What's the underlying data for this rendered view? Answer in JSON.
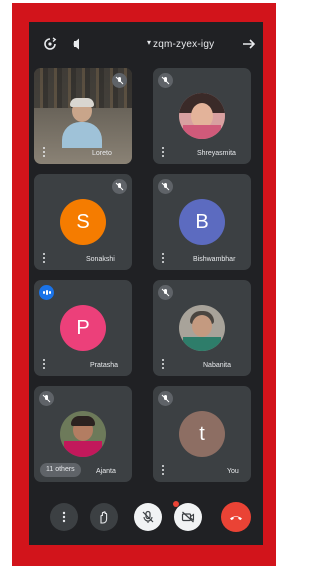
{
  "meeting": {
    "code": "zqm-zyex-igy",
    "caret": "▾"
  },
  "icons": {
    "back": "arrow-back-icon",
    "speaker": "speaker-icon",
    "switch_camera": "switch-camera-icon"
  },
  "tiles": [
    {
      "name": "Shreyasmita",
      "type": "photo",
      "muted": true
    },
    {
      "name": "Loreto",
      "type": "video",
      "muted": true
    },
    {
      "name": "Bishwambhar",
      "type": "initial",
      "initial": "B",
      "color": "#5c6bc0",
      "muted": true
    },
    {
      "name": "Sonakshi",
      "type": "initial",
      "initial": "S",
      "color": "#f57c00",
      "muted": true
    },
    {
      "name": "Nabanita",
      "type": "photo",
      "muted": true
    },
    {
      "name": "Pratasha",
      "type": "initial",
      "initial": "P",
      "color": "#ec407a",
      "muted": false,
      "speaking": true
    },
    {
      "name": "You",
      "type": "initial",
      "initial": "t",
      "color": "#8d6e63",
      "muted": true
    },
    {
      "name": "Ajanta",
      "type": "photo",
      "muted": true,
      "others_label": "11 others"
    }
  ],
  "controls": [
    "end-call",
    "camera-off",
    "mic-off",
    "raise-hand",
    "more-options"
  ],
  "colors": {
    "background": "#202124",
    "tile": "#3c4043",
    "end_call": "#ea4335",
    "frame": "#d2141b"
  }
}
